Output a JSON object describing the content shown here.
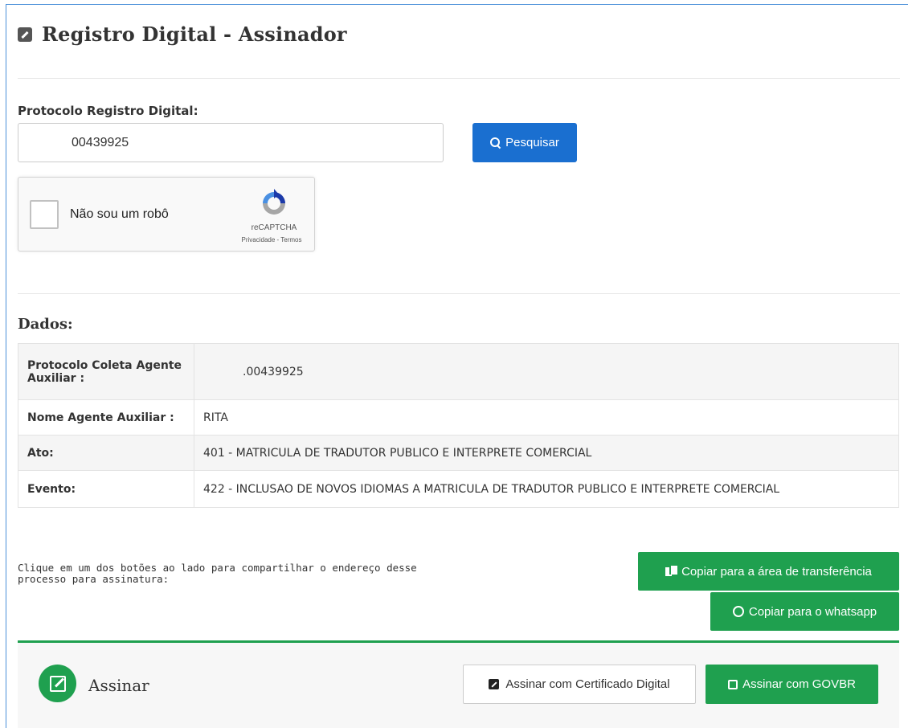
{
  "page": {
    "title": "Registro Digital - Assinador"
  },
  "search": {
    "label": "Protocolo Registro Digital:",
    "value": "00439925",
    "button_label": "Pesquisar"
  },
  "recaptcha": {
    "checkbox_label": "Não sou um robô",
    "brand": "reCAPTCHA",
    "links": "Privacidade - Termos"
  },
  "dados": {
    "heading": "Dados:",
    "rows": [
      {
        "key": "Protocolo Coleta Agente Auxiliar :",
        "value": ".00439925"
      },
      {
        "key": "Nome Agente Auxiliar :",
        "value": "RITA"
      },
      {
        "key": "Ato:",
        "value": "401 - MATRICULA DE TRADUTOR PUBLICO E INTERPRETE COMERCIAL"
      },
      {
        "key": "Evento:",
        "value": "422 - INCLUSAO DE NOVOS IDIOMAS A MATRICULA DE TRADUTOR PUBLICO E INTERPRETE COMERCIAL"
      }
    ]
  },
  "share": {
    "text": "Clique em um dos botões ao lado para compartilhar o endereço desse processo para assinatura:",
    "copy_button": "Copiar para a área de transferência",
    "whatsapp_button": "Copiar para o whatsapp"
  },
  "sign": {
    "label": "Assinar",
    "cert_button": "Assinar com Certificado Digital",
    "govbr_button": "Assinar com GOVBR"
  },
  "colors": {
    "primary": "#1a6fd0",
    "success": "#1fa04f",
    "frame_border": "#4a90d9"
  },
  "icons": [
    "edit-icon",
    "search-icon",
    "recaptcha-logo-icon",
    "copy-icon",
    "whatsapp-icon",
    "sign-icon",
    "certificate-icon",
    "govbr-edit-icon"
  ]
}
